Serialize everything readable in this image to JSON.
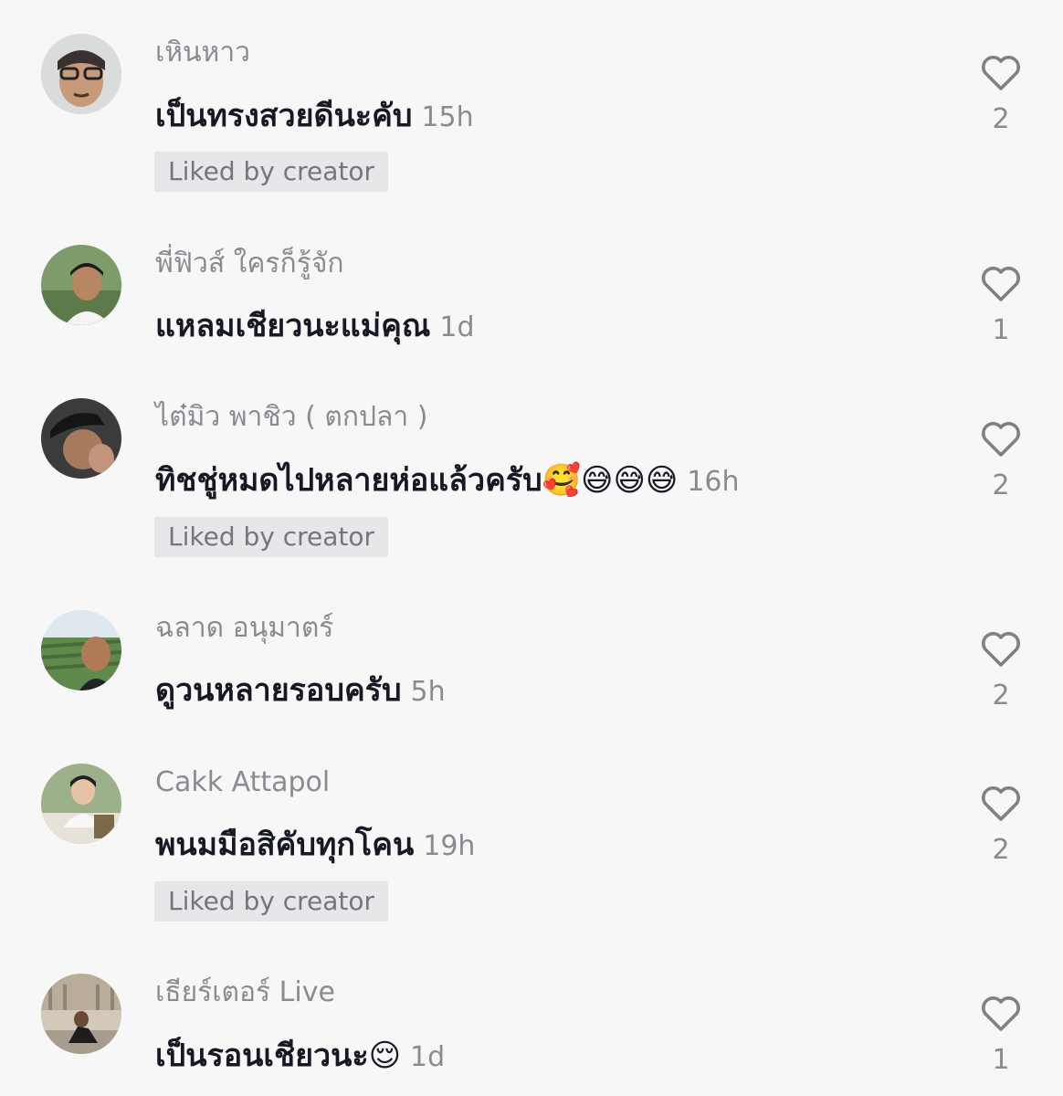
{
  "comments": [
    {
      "username": "เหินหาว",
      "text": "เป็นทรงสวยดีนะคับ",
      "time": "15h",
      "liked_label": "Liked by creator",
      "likes": "2"
    },
    {
      "username": "พี่ฟิวส์ ใครก็รู้จัก",
      "text": "แหลมเชียวนะแม่คุณ",
      "time": "1d",
      "likes": "1"
    },
    {
      "username": "ไต๋มิว พาชิว ( ตกปลา )",
      "text": "ทิชชู่หมดไปหลายห่อแล้วครับ🥰😅😅😅",
      "time": "16h",
      "liked_label": "Liked by creator",
      "likes": "2"
    },
    {
      "username": "ฉลาด อนุมาตร์",
      "text": "ดูวนหลายรอบครับ",
      "time": "5h",
      "likes": "2"
    },
    {
      "username": "Cakk Attapol",
      "text": "พนมมือสิคับทุกโคน",
      "time": "19h",
      "liked_label": "Liked by creator",
      "likes": "2"
    },
    {
      "username": "เธียร์เตอร์ Live",
      "text": "เป็นรอนเชียวนะ😌",
      "time": "1d",
      "likes": "1"
    }
  ],
  "icons": {
    "like": "heart-outline-icon"
  },
  "colors": {
    "background": "#f7f7f8",
    "username": "#8a8b91",
    "comment_text": "#161823",
    "liked_badge_bg": "#e7e7e9"
  }
}
